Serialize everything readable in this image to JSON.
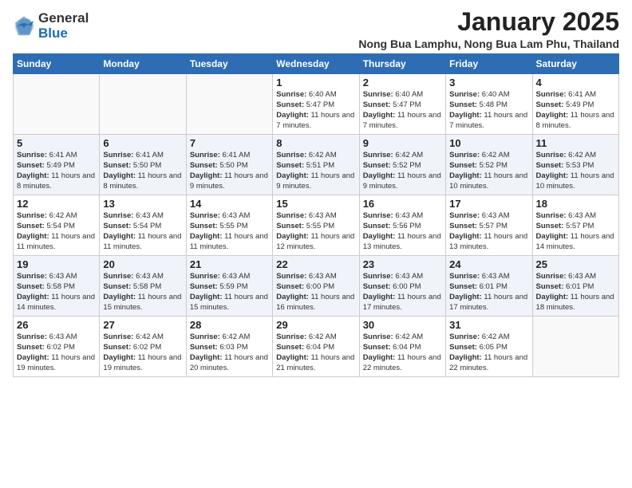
{
  "logo": {
    "general": "General",
    "blue": "Blue"
  },
  "title": "January 2025",
  "location": "Nong Bua Lamphu, Nong Bua Lam Phu, Thailand",
  "days_of_week": [
    "Sunday",
    "Monday",
    "Tuesday",
    "Wednesday",
    "Thursday",
    "Friday",
    "Saturday"
  ],
  "weeks": [
    [
      {
        "day": "",
        "info": ""
      },
      {
        "day": "",
        "info": ""
      },
      {
        "day": "",
        "info": ""
      },
      {
        "day": "1",
        "info": "Sunrise: 6:40 AM\nSunset: 5:47 PM\nDaylight: 11 hours and 7 minutes."
      },
      {
        "day": "2",
        "info": "Sunrise: 6:40 AM\nSunset: 5:47 PM\nDaylight: 11 hours and 7 minutes."
      },
      {
        "day": "3",
        "info": "Sunrise: 6:40 AM\nSunset: 5:48 PM\nDaylight: 11 hours and 7 minutes."
      },
      {
        "day": "4",
        "info": "Sunrise: 6:41 AM\nSunset: 5:49 PM\nDaylight: 11 hours and 8 minutes."
      }
    ],
    [
      {
        "day": "5",
        "info": "Sunrise: 6:41 AM\nSunset: 5:49 PM\nDaylight: 11 hours and 8 minutes."
      },
      {
        "day": "6",
        "info": "Sunrise: 6:41 AM\nSunset: 5:50 PM\nDaylight: 11 hours and 8 minutes."
      },
      {
        "day": "7",
        "info": "Sunrise: 6:41 AM\nSunset: 5:50 PM\nDaylight: 11 hours and 9 minutes."
      },
      {
        "day": "8",
        "info": "Sunrise: 6:42 AM\nSunset: 5:51 PM\nDaylight: 11 hours and 9 minutes."
      },
      {
        "day": "9",
        "info": "Sunrise: 6:42 AM\nSunset: 5:52 PM\nDaylight: 11 hours and 9 minutes."
      },
      {
        "day": "10",
        "info": "Sunrise: 6:42 AM\nSunset: 5:52 PM\nDaylight: 11 hours and 10 minutes."
      },
      {
        "day": "11",
        "info": "Sunrise: 6:42 AM\nSunset: 5:53 PM\nDaylight: 11 hours and 10 minutes."
      }
    ],
    [
      {
        "day": "12",
        "info": "Sunrise: 6:42 AM\nSunset: 5:54 PM\nDaylight: 11 hours and 11 minutes."
      },
      {
        "day": "13",
        "info": "Sunrise: 6:43 AM\nSunset: 5:54 PM\nDaylight: 11 hours and 11 minutes."
      },
      {
        "day": "14",
        "info": "Sunrise: 6:43 AM\nSunset: 5:55 PM\nDaylight: 11 hours and 11 minutes."
      },
      {
        "day": "15",
        "info": "Sunrise: 6:43 AM\nSunset: 5:55 PM\nDaylight: 11 hours and 12 minutes."
      },
      {
        "day": "16",
        "info": "Sunrise: 6:43 AM\nSunset: 5:56 PM\nDaylight: 11 hours and 13 minutes."
      },
      {
        "day": "17",
        "info": "Sunrise: 6:43 AM\nSunset: 5:57 PM\nDaylight: 11 hours and 13 minutes."
      },
      {
        "day": "18",
        "info": "Sunrise: 6:43 AM\nSunset: 5:57 PM\nDaylight: 11 hours and 14 minutes."
      }
    ],
    [
      {
        "day": "19",
        "info": "Sunrise: 6:43 AM\nSunset: 5:58 PM\nDaylight: 11 hours and 14 minutes."
      },
      {
        "day": "20",
        "info": "Sunrise: 6:43 AM\nSunset: 5:58 PM\nDaylight: 11 hours and 15 minutes."
      },
      {
        "day": "21",
        "info": "Sunrise: 6:43 AM\nSunset: 5:59 PM\nDaylight: 11 hours and 15 minutes."
      },
      {
        "day": "22",
        "info": "Sunrise: 6:43 AM\nSunset: 6:00 PM\nDaylight: 11 hours and 16 minutes."
      },
      {
        "day": "23",
        "info": "Sunrise: 6:43 AM\nSunset: 6:00 PM\nDaylight: 11 hours and 17 minutes."
      },
      {
        "day": "24",
        "info": "Sunrise: 6:43 AM\nSunset: 6:01 PM\nDaylight: 11 hours and 17 minutes."
      },
      {
        "day": "25",
        "info": "Sunrise: 6:43 AM\nSunset: 6:01 PM\nDaylight: 11 hours and 18 minutes."
      }
    ],
    [
      {
        "day": "26",
        "info": "Sunrise: 6:43 AM\nSunset: 6:02 PM\nDaylight: 11 hours and 19 minutes."
      },
      {
        "day": "27",
        "info": "Sunrise: 6:42 AM\nSunset: 6:02 PM\nDaylight: 11 hours and 19 minutes."
      },
      {
        "day": "28",
        "info": "Sunrise: 6:42 AM\nSunset: 6:03 PM\nDaylight: 11 hours and 20 minutes."
      },
      {
        "day": "29",
        "info": "Sunrise: 6:42 AM\nSunset: 6:04 PM\nDaylight: 11 hours and 21 minutes."
      },
      {
        "day": "30",
        "info": "Sunrise: 6:42 AM\nSunset: 6:04 PM\nDaylight: 11 hours and 22 minutes."
      },
      {
        "day": "31",
        "info": "Sunrise: 6:42 AM\nSunset: 6:05 PM\nDaylight: 11 hours and 22 minutes."
      },
      {
        "day": "",
        "info": ""
      }
    ]
  ]
}
